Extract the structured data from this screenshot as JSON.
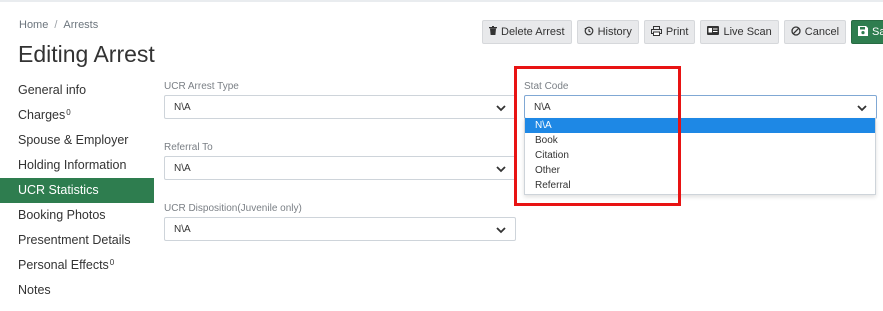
{
  "breadcrumb": {
    "home": "Home",
    "separator": "/",
    "current": "Arrests"
  },
  "page_title": "Editing Arrest",
  "toolbar": {
    "delete_label": "Delete Arrest",
    "history_label": "History",
    "print_label": "Print",
    "live_scan_label": "Live Scan",
    "cancel_label": "Cancel",
    "save_label": "Save"
  },
  "sidebar": {
    "items": [
      {
        "label": "General info",
        "badge": ""
      },
      {
        "label": "Charges",
        "badge": "0"
      },
      {
        "label": "Spouse & Employer",
        "badge": ""
      },
      {
        "label": "Holding Information",
        "badge": ""
      },
      {
        "label": "UCR Statistics",
        "badge": "",
        "active": true
      },
      {
        "label": "Booking Photos",
        "badge": ""
      },
      {
        "label": "Presentment Details",
        "badge": ""
      },
      {
        "label": "Personal Effects",
        "badge": "0"
      },
      {
        "label": "Notes",
        "badge": ""
      }
    ]
  },
  "form": {
    "ucr_arrest_type": {
      "label": "UCR Arrest Type",
      "value": "N\\A"
    },
    "referral_to": {
      "label": "Referral To",
      "value": "N\\A"
    },
    "ucr_disposition": {
      "label": "UCR Disposition(Juvenile only)",
      "value": "N\\A"
    },
    "stat_code": {
      "label": "Stat Code",
      "value": "N\\A",
      "options": [
        "N\\A",
        "Book",
        "Citation",
        "Other",
        "Referral"
      ],
      "selected_index": 0
    }
  },
  "colors": {
    "accent_green": "#2e7d4f",
    "option_highlight": "#1e88e5",
    "annotation_red": "#e81313"
  }
}
